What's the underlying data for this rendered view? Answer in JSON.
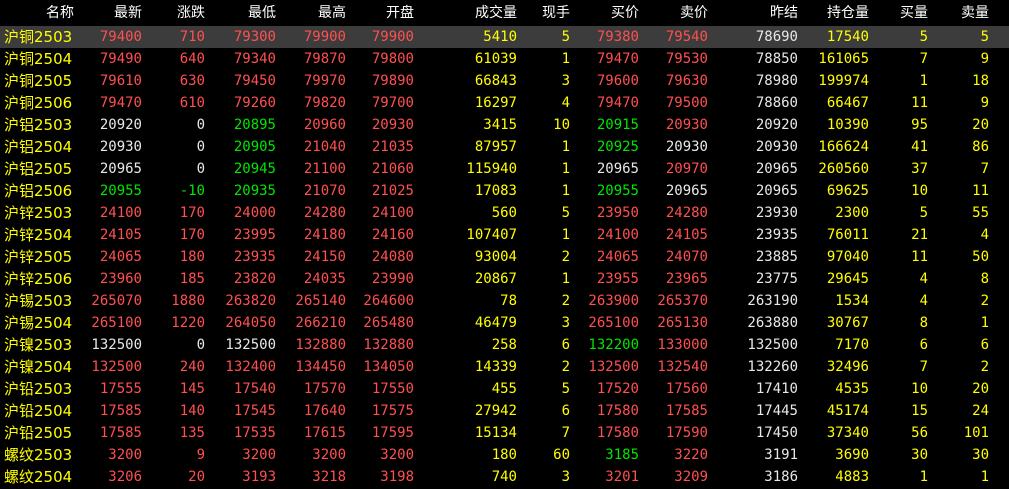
{
  "colors": {
    "background": "#000000",
    "selected_row": "#3c3c3c",
    "up": "#ff5050",
    "down": "#00e600",
    "flat": "#e8e8e8",
    "name": "#ffff00",
    "volume": "#ffff00",
    "header": "#ffffff"
  },
  "columns": [
    "名称",
    "最新",
    "涨跌",
    "最低",
    "最高",
    "开盘",
    "成交量",
    "现手",
    "买价",
    "卖价",
    "昨结",
    "持仓量",
    "买量",
    "卖量"
  ],
  "rows": [
    {
      "cells": [
        "沪铜2503",
        "79400",
        "710",
        "79300",
        "79900",
        "79900",
        "5410",
        "5",
        "79380",
        "79540",
        "78690",
        "17540",
        "5",
        "5"
      ],
      "colors": [
        "y",
        "r",
        "r",
        "r",
        "r",
        "r",
        "y",
        "y",
        "r",
        "r",
        "w",
        "y",
        "y",
        "y"
      ],
      "selected": true
    },
    {
      "cells": [
        "沪铜2504",
        "79490",
        "640",
        "79340",
        "79870",
        "79800",
        "61039",
        "1",
        "79470",
        "79530",
        "78850",
        "161065",
        "7",
        "9"
      ],
      "colors": [
        "y",
        "r",
        "r",
        "r",
        "r",
        "r",
        "y",
        "y",
        "r",
        "r",
        "w",
        "y",
        "y",
        "y"
      ]
    },
    {
      "cells": [
        "沪铜2505",
        "79610",
        "630",
        "79450",
        "79970",
        "79890",
        "66843",
        "3",
        "79600",
        "79630",
        "78980",
        "199974",
        "1",
        "18"
      ],
      "colors": [
        "y",
        "r",
        "r",
        "r",
        "r",
        "r",
        "y",
        "y",
        "r",
        "r",
        "w",
        "y",
        "y",
        "y"
      ]
    },
    {
      "cells": [
        "沪铜2506",
        "79470",
        "610",
        "79260",
        "79820",
        "79700",
        "16297",
        "4",
        "79470",
        "79500",
        "78860",
        "66467",
        "11",
        "9"
      ],
      "colors": [
        "y",
        "r",
        "r",
        "r",
        "r",
        "r",
        "y",
        "y",
        "r",
        "r",
        "w",
        "y",
        "y",
        "y"
      ]
    },
    {
      "cells": [
        "沪铝2503",
        "20920",
        "0",
        "20895",
        "20960",
        "20930",
        "3415",
        "10",
        "20915",
        "20930",
        "20920",
        "10390",
        "95",
        "20"
      ],
      "colors": [
        "y",
        "w",
        "w",
        "g",
        "r",
        "r",
        "y",
        "y",
        "g",
        "r",
        "w",
        "y",
        "y",
        "y"
      ]
    },
    {
      "cells": [
        "沪铝2504",
        "20930",
        "0",
        "20905",
        "21040",
        "21035",
        "87957",
        "1",
        "20925",
        "20930",
        "20930",
        "166624",
        "41",
        "86"
      ],
      "colors": [
        "y",
        "w",
        "w",
        "g",
        "r",
        "r",
        "y",
        "y",
        "g",
        "w",
        "w",
        "y",
        "y",
        "y"
      ]
    },
    {
      "cells": [
        "沪铝2505",
        "20965",
        "0",
        "20945",
        "21100",
        "21060",
        "115940",
        "1",
        "20965",
        "20970",
        "20965",
        "260560",
        "37",
        "7"
      ],
      "colors": [
        "y",
        "w",
        "w",
        "g",
        "r",
        "r",
        "y",
        "y",
        "w",
        "r",
        "w",
        "y",
        "y",
        "y"
      ]
    },
    {
      "cells": [
        "沪铝2506",
        "20955",
        "-10",
        "20935",
        "21070",
        "21025",
        "17083",
        "1",
        "20955",
        "20965",
        "20965",
        "69625",
        "10",
        "11"
      ],
      "colors": [
        "y",
        "g",
        "g",
        "g",
        "r",
        "r",
        "y",
        "y",
        "g",
        "w",
        "w",
        "y",
        "y",
        "y"
      ]
    },
    {
      "cells": [
        "沪锌2503",
        "24100",
        "170",
        "24000",
        "24280",
        "24100",
        "560",
        "5",
        "23950",
        "24280",
        "23930",
        "2300",
        "5",
        "55"
      ],
      "colors": [
        "y",
        "r",
        "r",
        "r",
        "r",
        "r",
        "y",
        "y",
        "r",
        "r",
        "w",
        "y",
        "y",
        "y"
      ]
    },
    {
      "cells": [
        "沪锌2504",
        "24105",
        "170",
        "23995",
        "24180",
        "24160",
        "107407",
        "1",
        "24100",
        "24105",
        "23935",
        "76011",
        "21",
        "4"
      ],
      "colors": [
        "y",
        "r",
        "r",
        "r",
        "r",
        "r",
        "y",
        "y",
        "r",
        "r",
        "w",
        "y",
        "y",
        "y"
      ]
    },
    {
      "cells": [
        "沪锌2505",
        "24065",
        "180",
        "23935",
        "24150",
        "24080",
        "93004",
        "2",
        "24065",
        "24070",
        "23885",
        "97040",
        "11",
        "50"
      ],
      "colors": [
        "y",
        "r",
        "r",
        "r",
        "r",
        "r",
        "y",
        "y",
        "r",
        "r",
        "w",
        "y",
        "y",
        "y"
      ]
    },
    {
      "cells": [
        "沪锌2506",
        "23960",
        "185",
        "23820",
        "24035",
        "23990",
        "20867",
        "1",
        "23955",
        "23965",
        "23775",
        "29645",
        "4",
        "8"
      ],
      "colors": [
        "y",
        "r",
        "r",
        "r",
        "r",
        "r",
        "y",
        "y",
        "r",
        "r",
        "w",
        "y",
        "y",
        "y"
      ]
    },
    {
      "cells": [
        "沪锡2503",
        "265070",
        "1880",
        "263820",
        "265140",
        "264600",
        "78",
        "2",
        "263900",
        "265370",
        "263190",
        "1534",
        "4",
        "2"
      ],
      "colors": [
        "y",
        "r",
        "r",
        "r",
        "r",
        "r",
        "y",
        "y",
        "r",
        "r",
        "w",
        "y",
        "y",
        "y"
      ]
    },
    {
      "cells": [
        "沪锡2504",
        "265100",
        "1220",
        "264050",
        "266210",
        "265480",
        "46479",
        "3",
        "265100",
        "265130",
        "263880",
        "30767",
        "8",
        "1"
      ],
      "colors": [
        "y",
        "r",
        "r",
        "r",
        "r",
        "r",
        "y",
        "y",
        "r",
        "r",
        "w",
        "y",
        "y",
        "y"
      ]
    },
    {
      "cells": [
        "沪镍2503",
        "132500",
        "0",
        "132500",
        "132880",
        "132880",
        "258",
        "6",
        "132200",
        "133000",
        "132500",
        "7170",
        "6",
        "6"
      ],
      "colors": [
        "y",
        "w",
        "w",
        "w",
        "r",
        "r",
        "y",
        "y",
        "g",
        "r",
        "w",
        "y",
        "y",
        "y"
      ]
    },
    {
      "cells": [
        "沪镍2504",
        "132500",
        "240",
        "132400",
        "134450",
        "134050",
        "14339",
        "2",
        "132500",
        "132540",
        "132260",
        "32496",
        "7",
        "2"
      ],
      "colors": [
        "y",
        "r",
        "r",
        "r",
        "r",
        "r",
        "y",
        "y",
        "r",
        "r",
        "w",
        "y",
        "y",
        "y"
      ]
    },
    {
      "cells": [
        "沪铅2503",
        "17555",
        "145",
        "17540",
        "17570",
        "17550",
        "455",
        "5",
        "17520",
        "17560",
        "17410",
        "4535",
        "10",
        "20"
      ],
      "colors": [
        "y",
        "r",
        "r",
        "r",
        "r",
        "r",
        "y",
        "y",
        "r",
        "r",
        "w",
        "y",
        "y",
        "y"
      ]
    },
    {
      "cells": [
        "沪铅2504",
        "17585",
        "140",
        "17545",
        "17640",
        "17575",
        "27942",
        "6",
        "17580",
        "17585",
        "17445",
        "45174",
        "15",
        "24"
      ],
      "colors": [
        "y",
        "r",
        "r",
        "r",
        "r",
        "r",
        "y",
        "y",
        "r",
        "r",
        "w",
        "y",
        "y",
        "y"
      ]
    },
    {
      "cells": [
        "沪铅2505",
        "17585",
        "135",
        "17535",
        "17615",
        "17595",
        "15134",
        "7",
        "17580",
        "17590",
        "17450",
        "37340",
        "56",
        "101"
      ],
      "colors": [
        "y",
        "r",
        "r",
        "r",
        "r",
        "r",
        "y",
        "y",
        "r",
        "r",
        "w",
        "y",
        "y",
        "y"
      ]
    },
    {
      "cells": [
        "螺纹2503",
        "3200",
        "9",
        "3200",
        "3200",
        "3200",
        "180",
        "60",
        "3185",
        "3220",
        "3191",
        "3690",
        "30",
        "30"
      ],
      "colors": [
        "y",
        "r",
        "r",
        "r",
        "r",
        "r",
        "y",
        "y",
        "g",
        "r",
        "w",
        "y",
        "y",
        "y"
      ]
    },
    {
      "cells": [
        "螺纹2504",
        "3206",
        "20",
        "3193",
        "3218",
        "3198",
        "740",
        "3",
        "3201",
        "3209",
        "3186",
        "4883",
        "1",
        "1"
      ],
      "colors": [
        "y",
        "r",
        "r",
        "r",
        "r",
        "r",
        "y",
        "y",
        "r",
        "r",
        "w",
        "y",
        "y",
        "y"
      ]
    }
  ]
}
